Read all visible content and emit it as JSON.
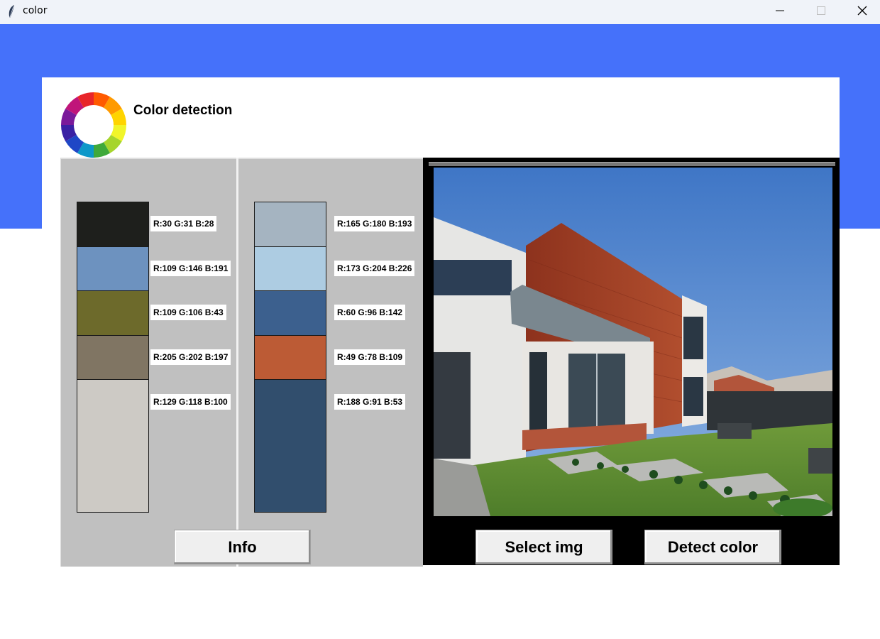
{
  "window": {
    "title": "color",
    "icon": "feather-icon"
  },
  "app": {
    "heading": "Color detection",
    "logo": "color-wheel-logo"
  },
  "palette_left": [
    {
      "color": "#1e1f1c",
      "label": "R:30 G:31 B:28"
    },
    {
      "color": "#6d92bf",
      "label": "R:109 G:146 B:191"
    },
    {
      "color": "#6d6a2b",
      "label": "R:109 G:106 B:43"
    },
    {
      "color": "#807563",
      "label": "R:205 G:202 B:197"
    },
    {
      "color": "#cdcac5",
      "label": "R:129 G:118 B:100"
    }
  ],
  "palette_right": [
    {
      "color": "#a5b4c1",
      "label": "R:165 G:180 B:193"
    },
    {
      "color": "#adcce2",
      "label": "R:173 G:204 B:226"
    },
    {
      "color": "#3c608e",
      "label": "R:60 G:96 B:142"
    },
    {
      "color": "#bc5b35",
      "label": "R:49 G:78 B:109"
    },
    {
      "color": "#314e6d",
      "label": "R:188 G:91 B:53"
    }
  ],
  "buttons": {
    "info": "Info",
    "select_img": "Select img",
    "detect_color": "Detect color"
  },
  "image": {
    "subject": "modern house with red timber cladding and lawn",
    "sky": "#5d8fd0",
    "cladding": "#9b3f26",
    "lawn": "#5f8f35"
  }
}
